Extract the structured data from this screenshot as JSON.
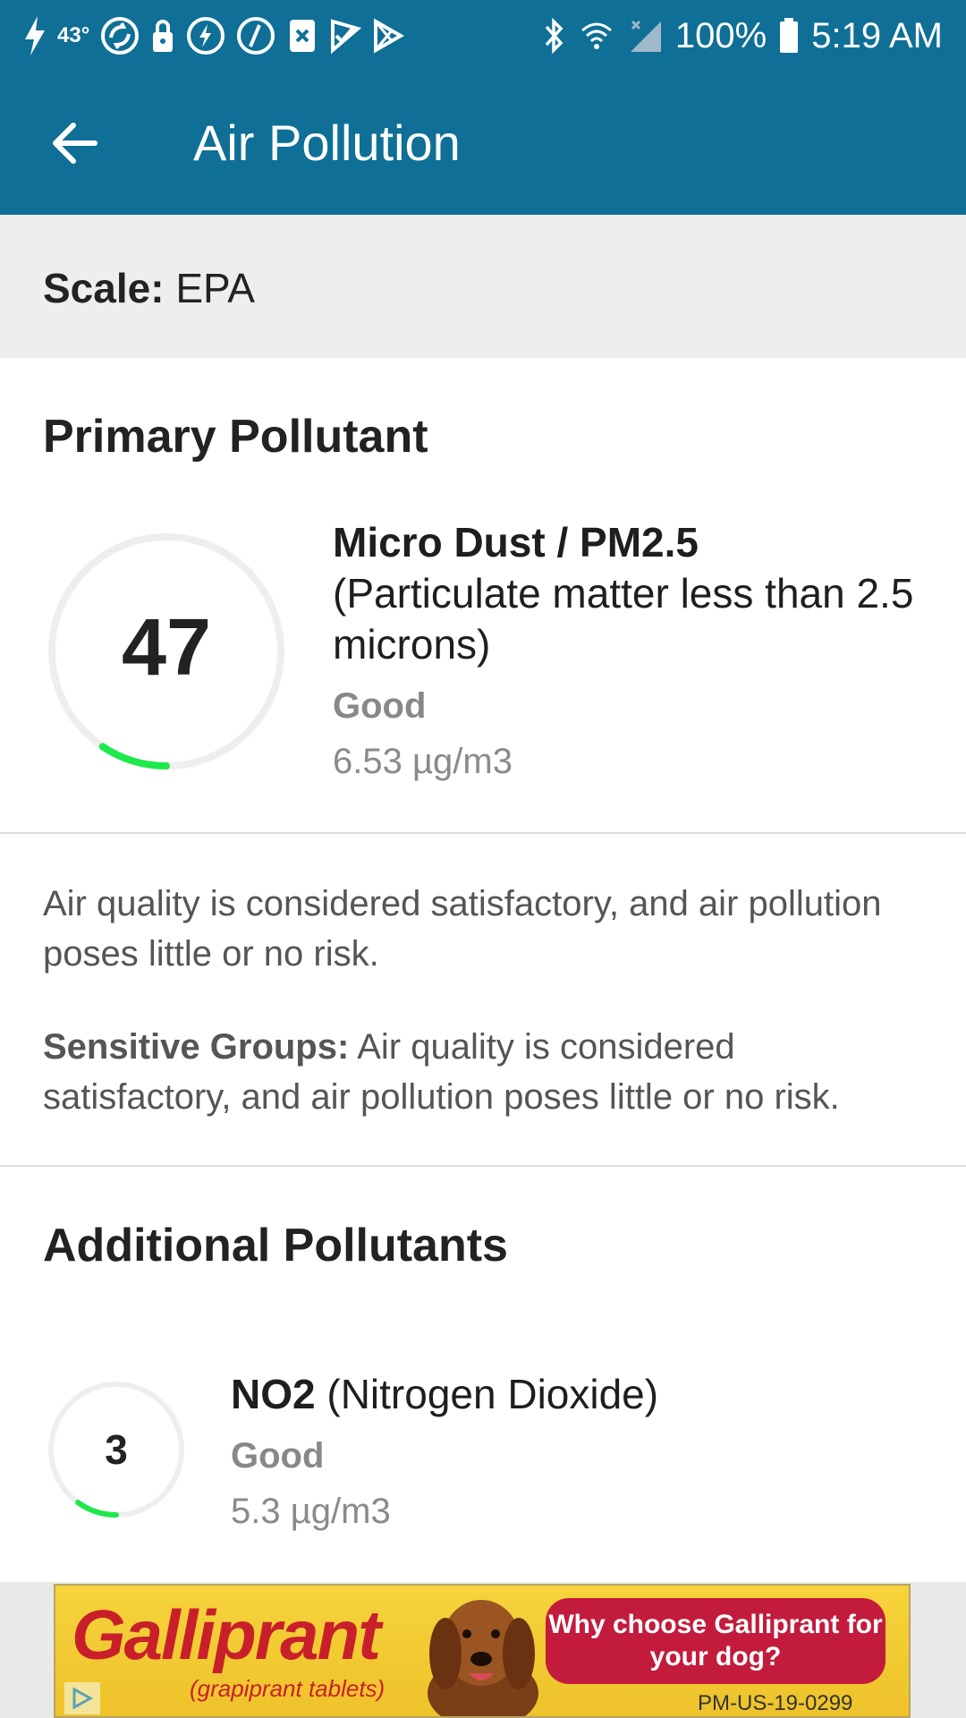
{
  "status_bar": {
    "temperature": "43°",
    "battery": "100%",
    "time": "5:19 AM",
    "left_icons": [
      "flash-icon",
      "temperature",
      "sync-icon",
      "lock-icon",
      "lightning-circle-icon",
      "lightning-circle-icon",
      "app-close-icon",
      "check-flag-icon",
      "play-store-icon"
    ],
    "right_icons": [
      "bluetooth-icon",
      "wifi-icon",
      "signal-icon",
      "battery-icon"
    ]
  },
  "app_bar": {
    "title": "Air Pollution",
    "back_icon": "arrow-left-icon"
  },
  "scale": {
    "label": "Scale:",
    "value": "EPA"
  },
  "primary": {
    "heading": "Primary Pollutant",
    "aqi": "47",
    "aqi_fraction": 0.094,
    "name_bold": "Micro Dust / PM2.5",
    "name_rest": "(Particulate matter less than 2.5 microns)",
    "status": "Good",
    "concentration": "6.53 µg/m3",
    "description": "Air quality is considered satisfactory, and air pollution poses little or no risk.",
    "sensitive_label": "Sensitive Groups:",
    "sensitive_text": "Air quality is considered satisfactory, and air pollution poses little or no risk."
  },
  "additional": {
    "heading": "Additional Pollutants",
    "items": [
      {
        "aqi": "3",
        "aqi_fraction": 0.1,
        "name_bold": "NO2",
        "name_rest": "(Nitrogen Dioxide)",
        "status": "Good",
        "concentration": "5.3 µg/m3"
      }
    ]
  },
  "colors": {
    "app_bar": "#0f6f96",
    "gauge_track": "#eeeeee",
    "gauge_good": "#1ee84a",
    "ad_background": "#f2cb33",
    "ad_red": "#c31b3c"
  },
  "ad": {
    "brand": "Galliprant",
    "subtitle": "(grapiprant tablets)",
    "cta": "Why choose Galliprant for your dog?",
    "code": "PM-US-19-0299",
    "adchoices_icon": "adchoices-icon"
  }
}
